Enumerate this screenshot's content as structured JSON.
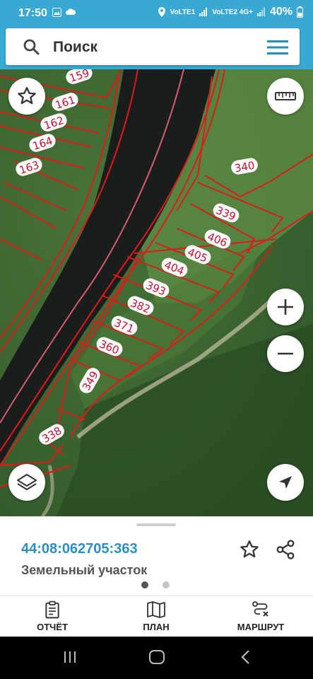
{
  "status_bar": {
    "time": "17:50",
    "network_1": "VoLTE1",
    "network_2": "VoLTE2 4G+",
    "battery": "40%"
  },
  "search": {
    "placeholder": "Поиск"
  },
  "map": {
    "parcels": [
      "159",
      "161",
      "162",
      "164",
      "163",
      "340",
      "339",
      "406",
      "405",
      "404",
      "393",
      "382",
      "371",
      "360",
      "349",
      "338"
    ],
    "colors": {
      "boundary": "#e01a1a",
      "label_text": "#c8102e",
      "river": "#1a1d1c",
      "vegetation": "#355d2c"
    }
  },
  "parcel": {
    "cadastral_number": "44:08:062705:363",
    "type": "Земельный участок"
  },
  "pager": {
    "active_index": 0,
    "count": 2
  },
  "tabs": [
    {
      "label": "ОТЧЁТ",
      "icon": "report-icon"
    },
    {
      "label": "ПЛАН",
      "icon": "map-plan-icon"
    },
    {
      "label": "МАРШРУТ",
      "icon": "route-icon"
    }
  ],
  "colors": {
    "accent": "#38a9d4",
    "link": "#2b8fc0"
  }
}
